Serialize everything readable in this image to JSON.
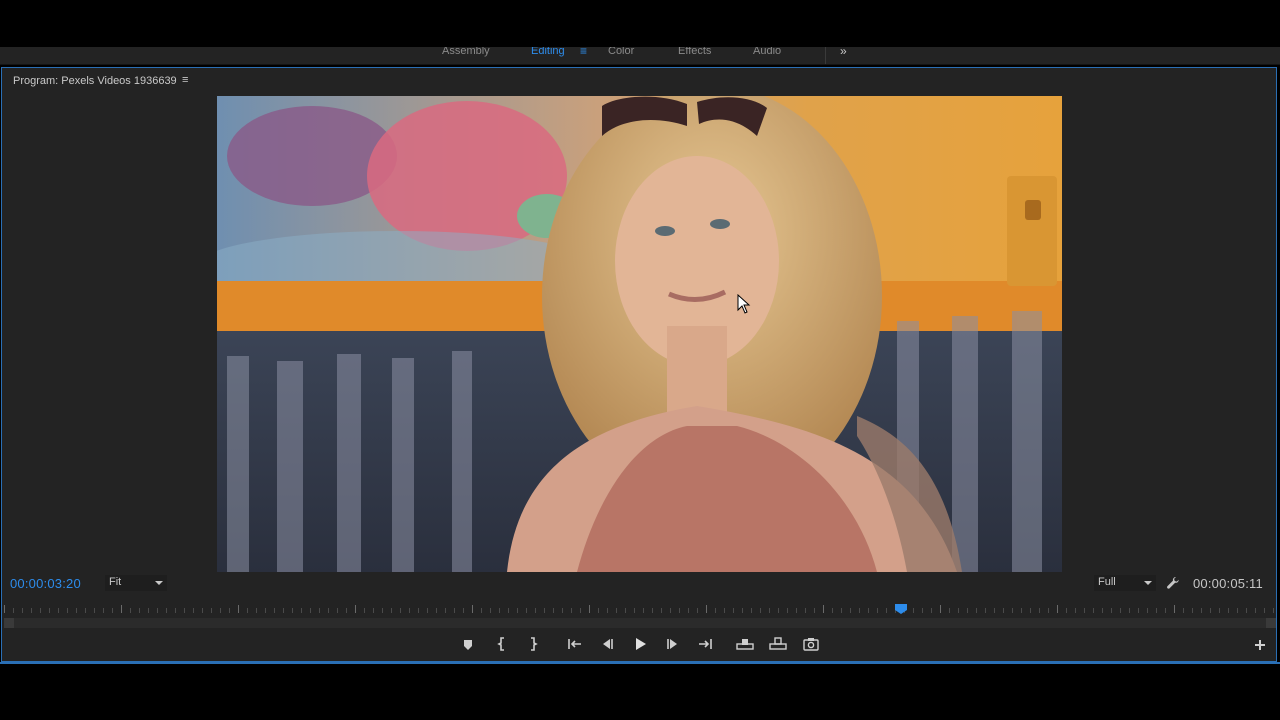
{
  "workspaces": {
    "tabs": [
      {
        "label": "Assembly",
        "active": false
      },
      {
        "label": "Editing",
        "active": true
      },
      {
        "label": "Color",
        "active": false
      },
      {
        "label": "Effects",
        "active": false
      },
      {
        "label": "Audio",
        "active": false
      }
    ],
    "menu_icon": "hamburger-icon",
    "overflow_icon": "double-chevron-right-icon"
  },
  "monitor": {
    "title": "Program: Pexels Videos 1936639",
    "menu_icon": "hamburger-icon",
    "timecode_current": "00:00:03:20",
    "timecode_duration": "00:00:05:11",
    "zoom_select": {
      "selected": "Fit"
    },
    "resolution_select": {
      "selected": "Full"
    },
    "settings_icon": "wrench-icon",
    "playhead_fraction": 0.705,
    "accent_color": "#2d8ceb"
  },
  "transport": {
    "buttons": [
      {
        "name": "add-marker-button",
        "icon": "marker-icon"
      },
      {
        "name": "mark-in-button",
        "icon": "mark-in-icon"
      },
      {
        "name": "mark-out-button",
        "icon": "mark-out-icon"
      },
      {
        "name": "go-to-in-button",
        "icon": "go-to-in-icon"
      },
      {
        "name": "step-back-button",
        "icon": "step-back-icon"
      },
      {
        "name": "play-button",
        "icon": "play-icon"
      },
      {
        "name": "step-forward-button",
        "icon": "step-forward-icon"
      },
      {
        "name": "go-to-out-button",
        "icon": "go-to-out-icon"
      },
      {
        "name": "lift-button",
        "icon": "lift-icon"
      },
      {
        "name": "extract-button",
        "icon": "extract-icon"
      },
      {
        "name": "export-frame-button",
        "icon": "camera-icon"
      }
    ],
    "add_button_icon": "plus-icon"
  }
}
